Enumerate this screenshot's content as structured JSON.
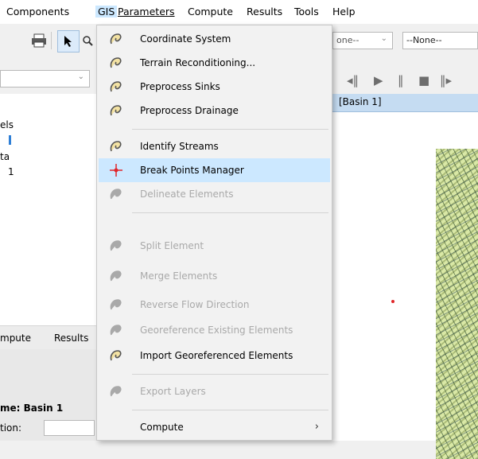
{
  "menubar": {
    "items": [
      {
        "label": "Components"
      },
      {
        "label": "GIS"
      },
      {
        "label": "Parameters"
      },
      {
        "label": "Compute"
      },
      {
        "label": "Results"
      },
      {
        "label": "Tools"
      },
      {
        "label": "Help"
      }
    ]
  },
  "toolbar": {
    "combo_none_1": "one--",
    "combo_none_2": "--None--"
  },
  "left_panel": {
    "tree": [
      "els",
      "ta",
      "1"
    ],
    "tabs": [
      "mpute",
      "Results"
    ],
    "properties": {
      "name_label": "me: Basin 1",
      "location_label": "tion:"
    }
  },
  "map_panel": {
    "title": "[Basin 1]"
  },
  "gis_menu": {
    "items": [
      {
        "label": "Coordinate System",
        "enabled": true,
        "icon": "gis-tool-icon"
      },
      {
        "label": "Terrain Reconditioning...",
        "enabled": true,
        "icon": "gis-tool-icon"
      },
      {
        "label": "Preprocess Sinks",
        "enabled": true,
        "icon": "gis-tool-icon"
      },
      {
        "label": "Preprocess Drainage",
        "enabled": true,
        "icon": "gis-tool-icon"
      },
      {
        "label": "Identify Streams",
        "enabled": true,
        "icon": "gis-tool-icon"
      },
      {
        "label": "Break Points Manager",
        "enabled": true,
        "highlighted": true,
        "icon": "break-point-icon"
      },
      {
        "label": "Delineate Elements",
        "enabled": false,
        "icon": "gis-tool-icon"
      },
      {
        "label": "Split Element",
        "enabled": false,
        "icon": "gis-tool-icon"
      },
      {
        "label": "Merge Elements",
        "enabled": false,
        "icon": "gis-tool-icon"
      },
      {
        "label": "Reverse Flow Direction",
        "enabled": false,
        "icon": "gis-tool-icon"
      },
      {
        "label": "Georeference Existing Elements",
        "enabled": false,
        "icon": "gis-tool-icon"
      },
      {
        "label": "Import Georeferenced Elements",
        "enabled": true,
        "icon": "gis-tool-icon"
      },
      {
        "label": "Export Layers",
        "enabled": false,
        "icon": "gis-tool-icon"
      },
      {
        "label": "Compute",
        "enabled": true,
        "submenu_arrow": "›"
      }
    ]
  },
  "colors": {
    "highlight": "#cce8ff",
    "disabled_text": "#a9a9a9",
    "tree_accent": "#2f7fd6"
  }
}
